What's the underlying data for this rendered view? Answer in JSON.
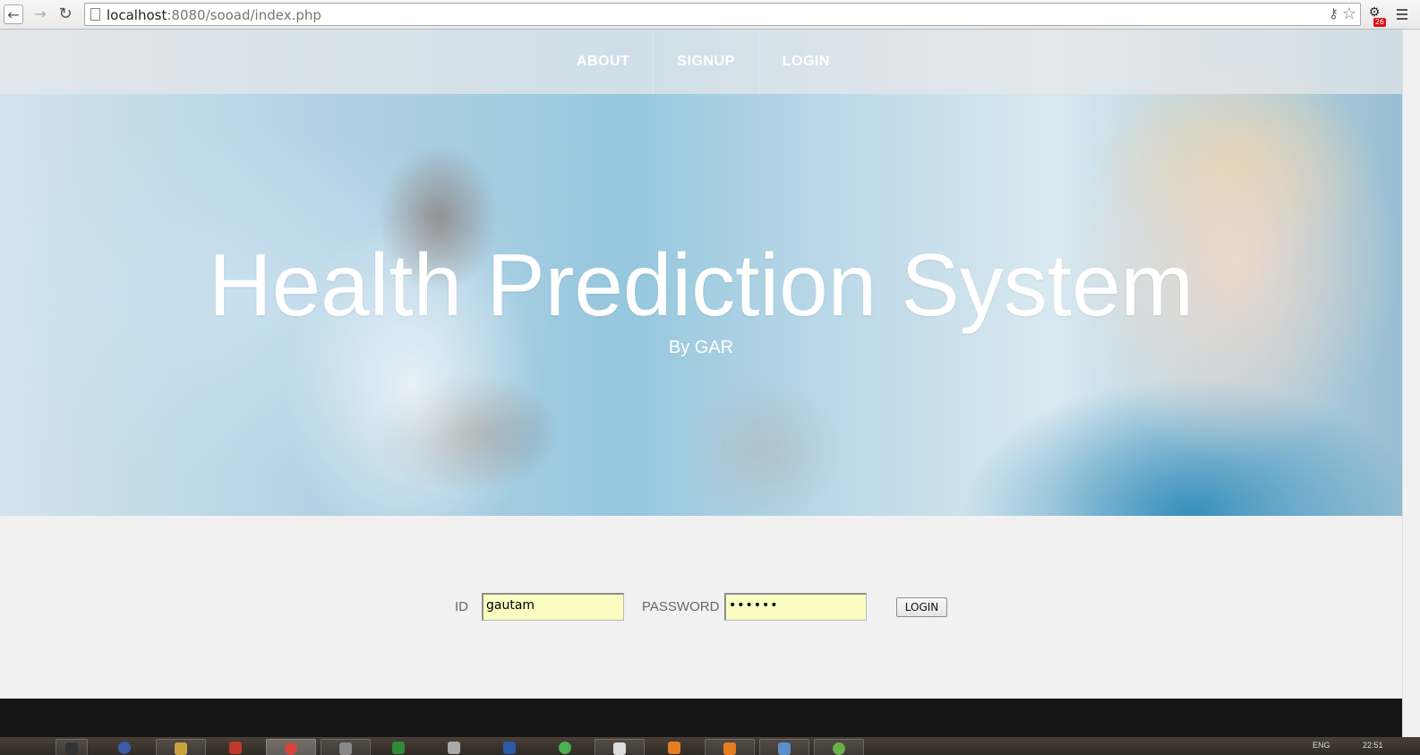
{
  "browser": {
    "url_host": "localhost",
    "url_rest": ":8080/sooad/index.php",
    "extension_badge": "26"
  },
  "nav": {
    "items": [
      {
        "label": "ABOUT"
      },
      {
        "label": "SIGNUP"
      },
      {
        "label": "LOGIN"
      }
    ]
  },
  "hero": {
    "title": "Health Prediction System",
    "subtitle": "By GAR"
  },
  "login_form": {
    "id_label": "ID",
    "id_value": "gautam",
    "password_label": "PASSWORD",
    "password_value": "••••••",
    "submit_label": "LOGIN"
  },
  "taskbar": {
    "tray_lang": "ENG",
    "tray_time": "22:51"
  },
  "colors": {
    "footer": "#161616",
    "page_bg": "#f1f1f1",
    "autofill_field": "#fbfcc1",
    "nav_text": "#ffffff"
  }
}
